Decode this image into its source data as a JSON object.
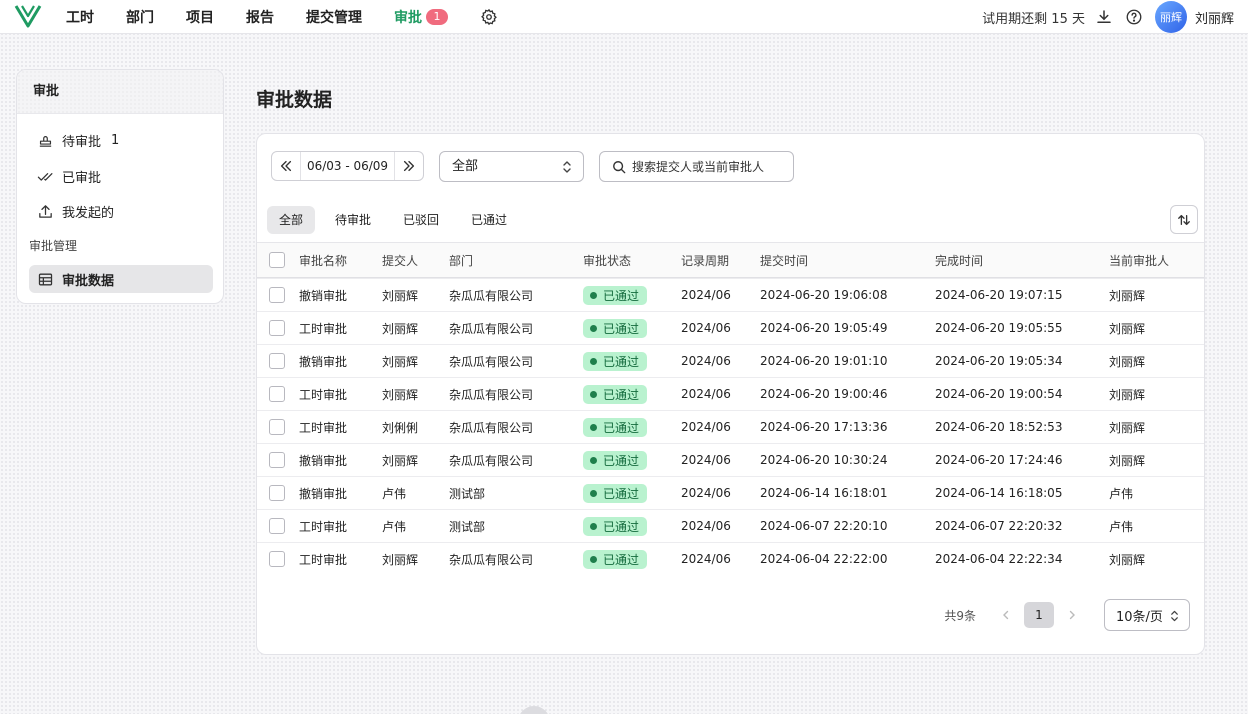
{
  "nav": {
    "items": [
      "工时",
      "部门",
      "项目",
      "报告",
      "提交管理",
      "审批"
    ],
    "approval_badge": "1",
    "trial_text": "试用期还剩 15 天",
    "avatar_text": "丽辉",
    "username": "刘丽辉"
  },
  "sidebar": {
    "header": "审批",
    "items": [
      {
        "label": "待审批",
        "count": "1",
        "icon": "stamp-icon"
      },
      {
        "label": "已审批",
        "icon": "double-check-icon"
      },
      {
        "label": "我发起的",
        "icon": "upload-icon"
      }
    ],
    "group_label": "审批管理",
    "data_item": {
      "label": "审批数据",
      "icon": "table-icon"
    }
  },
  "page": {
    "title": "审批数据"
  },
  "filters": {
    "date_range": "06/03 - 06/09",
    "select_value": "全部",
    "search_placeholder": "搜索提交人或当前审批人"
  },
  "tabs": [
    "全部",
    "待审批",
    "已驳回",
    "已通过"
  ],
  "table": {
    "columns": [
      "审批名称",
      "提交人",
      "部门",
      "审批状态",
      "记录周期",
      "提交时间",
      "完成时间",
      "当前审批人"
    ],
    "rows": [
      [
        "撤销审批",
        "刘丽辉",
        "杂瓜瓜有限公司",
        "已通过",
        "2024/06",
        "2024-06-20 19:06:08",
        "2024-06-20 19:07:15",
        "刘丽辉"
      ],
      [
        "工时审批",
        "刘丽辉",
        "杂瓜瓜有限公司",
        "已通过",
        "2024/06",
        "2024-06-20 19:05:49",
        "2024-06-20 19:05:55",
        "刘丽辉"
      ],
      [
        "撤销审批",
        "刘丽辉",
        "杂瓜瓜有限公司",
        "已通过",
        "2024/06",
        "2024-06-20 19:01:10",
        "2024-06-20 19:05:34",
        "刘丽辉"
      ],
      [
        "工时审批",
        "刘丽辉",
        "杂瓜瓜有限公司",
        "已通过",
        "2024/06",
        "2024-06-20 19:00:46",
        "2024-06-20 19:00:54",
        "刘丽辉"
      ],
      [
        "工时审批",
        "刘俐俐",
        "杂瓜瓜有限公司",
        "已通过",
        "2024/06",
        "2024-06-20 17:13:36",
        "2024-06-20 18:52:53",
        "刘丽辉"
      ],
      [
        "撤销审批",
        "刘丽辉",
        "杂瓜瓜有限公司",
        "已通过",
        "2024/06",
        "2024-06-20 10:30:24",
        "2024-06-20 17:24:46",
        "刘丽辉"
      ],
      [
        "撤销审批",
        "卢伟",
        "测试部",
        "已通过",
        "2024/06",
        "2024-06-14 16:18:01",
        "2024-06-14 16:18:05",
        "卢伟"
      ],
      [
        "工时审批",
        "卢伟",
        "测试部",
        "已通过",
        "2024/06",
        "2024-06-07 22:20:10",
        "2024-06-07 22:20:32",
        "卢伟"
      ],
      [
        "工时审批",
        "刘丽辉",
        "杂瓜瓜有限公司",
        "已通过",
        "2024/06",
        "2024-06-04 22:22:00",
        "2024-06-04 22:22:34",
        "刘丽辉"
      ]
    ]
  },
  "pagination": {
    "total": "共9条",
    "current_page": "1",
    "page_size": "10条/页"
  },
  "colors": {
    "accent": "#1f9b62",
    "badge": "#f06b7e",
    "status_bg": "#b9f2cf",
    "status_text": "#146b3d"
  }
}
